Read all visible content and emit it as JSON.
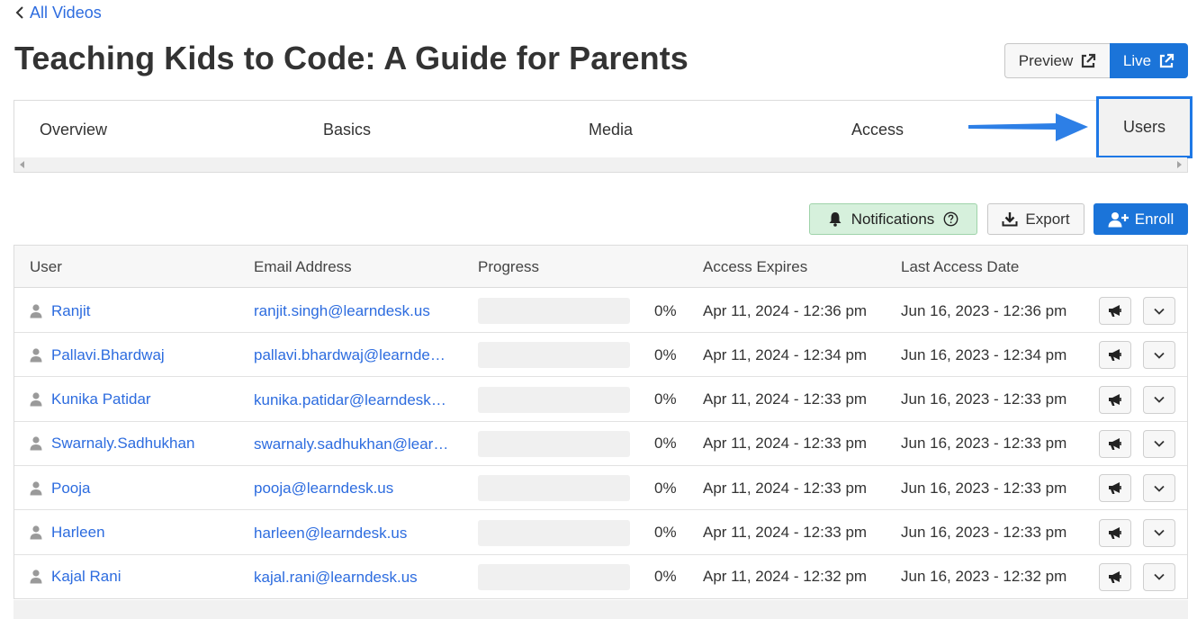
{
  "nav": {
    "back_label": "All Videos"
  },
  "page": {
    "title": "Teaching Kids to Code: A Guide for Parents"
  },
  "header_buttons": {
    "preview_label": "Preview",
    "live_label": "Live"
  },
  "tabs": [
    {
      "label": "Overview"
    },
    {
      "label": "Basics"
    },
    {
      "label": "Media"
    },
    {
      "label": "Access"
    },
    {
      "label": "Users",
      "active": true
    }
  ],
  "toolbar": {
    "notifications_label": "Notifications",
    "export_label": "Export",
    "enroll_label": "Enroll"
  },
  "colors": {
    "primary": "#1b74d9",
    "link": "#2d6cdf",
    "highlight_border": "#1e78e6",
    "notifications_bg": "#d6f0dc"
  },
  "table": {
    "columns": [
      "User",
      "Email Address",
      "Progress",
      "Access Expires",
      "Last Access Date"
    ],
    "rows": [
      {
        "user": "Ranjit",
        "email": "ranjit.singh@learndesk.us",
        "progress": 0,
        "progress_label": "0%",
        "access_expires": "Apr 11, 2024 - 12:36 pm",
        "last_access": "Jun 16, 2023 - 12:36 pm"
      },
      {
        "user": "Pallavi.Bhardwaj",
        "email": "pallavi.bhardwaj@learndesk.us",
        "progress": 0,
        "progress_label": "0%",
        "access_expires": "Apr 11, 2024 - 12:34 pm",
        "last_access": "Jun 16, 2023 - 12:34 pm"
      },
      {
        "user": "Kunika Patidar",
        "email": "kunika.patidar@learndesk.us",
        "progress": 0,
        "progress_label": "0%",
        "access_expires": "Apr 11, 2024 - 12:33 pm",
        "last_access": "Jun 16, 2023 - 12:33 pm"
      },
      {
        "user": "Swarnaly.Sadhukhan",
        "email": "swarnaly.sadhukhan@learndesk.us",
        "progress": 0,
        "progress_label": "0%",
        "access_expires": "Apr 11, 2024 - 12:33 pm",
        "last_access": "Jun 16, 2023 - 12:33 pm"
      },
      {
        "user": "Pooja",
        "email": "pooja@learndesk.us",
        "progress": 0,
        "progress_label": "0%",
        "access_expires": "Apr 11, 2024 - 12:33 pm",
        "last_access": "Jun 16, 2023 - 12:33 pm"
      },
      {
        "user": "Harleen",
        "email": "harleen@learndesk.us",
        "progress": 0,
        "progress_label": "0%",
        "access_expires": "Apr 11, 2024 - 12:33 pm",
        "last_access": "Jun 16, 2023 - 12:33 pm"
      },
      {
        "user": "Kajal Rani",
        "email": "kajal.rani@learndesk.us",
        "progress": 0,
        "progress_label": "0%",
        "access_expires": "Apr 11, 2024 - 12:32 pm",
        "last_access": "Jun 16, 2023 - 12:32 pm"
      }
    ]
  }
}
